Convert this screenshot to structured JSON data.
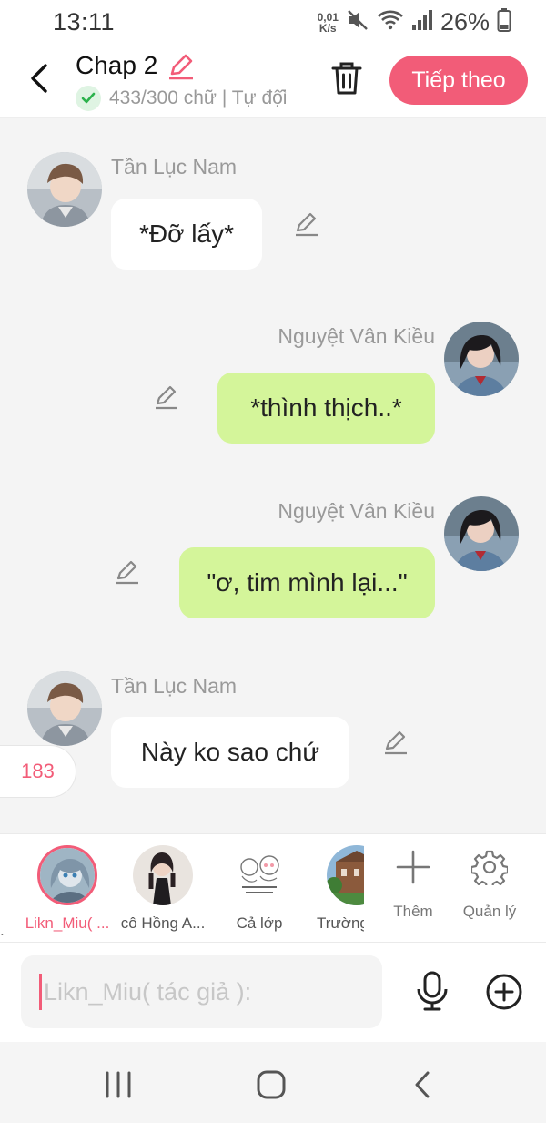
{
  "status_bar": {
    "time": "13:11",
    "net_speed_value": "0,01",
    "net_speed_unit": "K/s",
    "battery": "26%",
    "icons": [
      "mute-icon",
      "wifi-icon",
      "signal-icon",
      "battery-icon"
    ]
  },
  "header": {
    "title": "Chap 2",
    "word_count": "433/300 chữ | Tự độ̂i",
    "next_label": "Tiếp theo",
    "accent_color": "#f25c78"
  },
  "messages": [
    {
      "speaker": "Tần Lục Nam",
      "text": "*Đỡ lấy*",
      "side": "left",
      "bubble_color": "#ffffff"
    },
    {
      "speaker": "Nguyệt Vân Kiều",
      "text": "*thình thịch..*",
      "side": "right",
      "bubble_color": "#d4f59a"
    },
    {
      "speaker": "Nguyệt Vân Kiều",
      "text": "\"ơ, tim mình lại...\"",
      "side": "right",
      "bubble_color": "#d4f59a"
    },
    {
      "speaker": "Tần Lục Nam",
      "text": "Này ko sao chứ",
      "side": "left",
      "bubble_color": "#ffffff"
    }
  ],
  "message_count": "183",
  "characters": [
    {
      "label": "Likn_Miu( ...",
      "active": true
    },
    {
      "label": "cô Hồng A...",
      "active": false
    },
    {
      "label": "Cả lớp",
      "active": false
    },
    {
      "label": "Trường",
      "active": false
    }
  ],
  "tools": {
    "add_label": "Thêm",
    "manage_label": "Quản lý"
  },
  "input": {
    "placeholder": "Likn_Miu( tác giả ):"
  }
}
